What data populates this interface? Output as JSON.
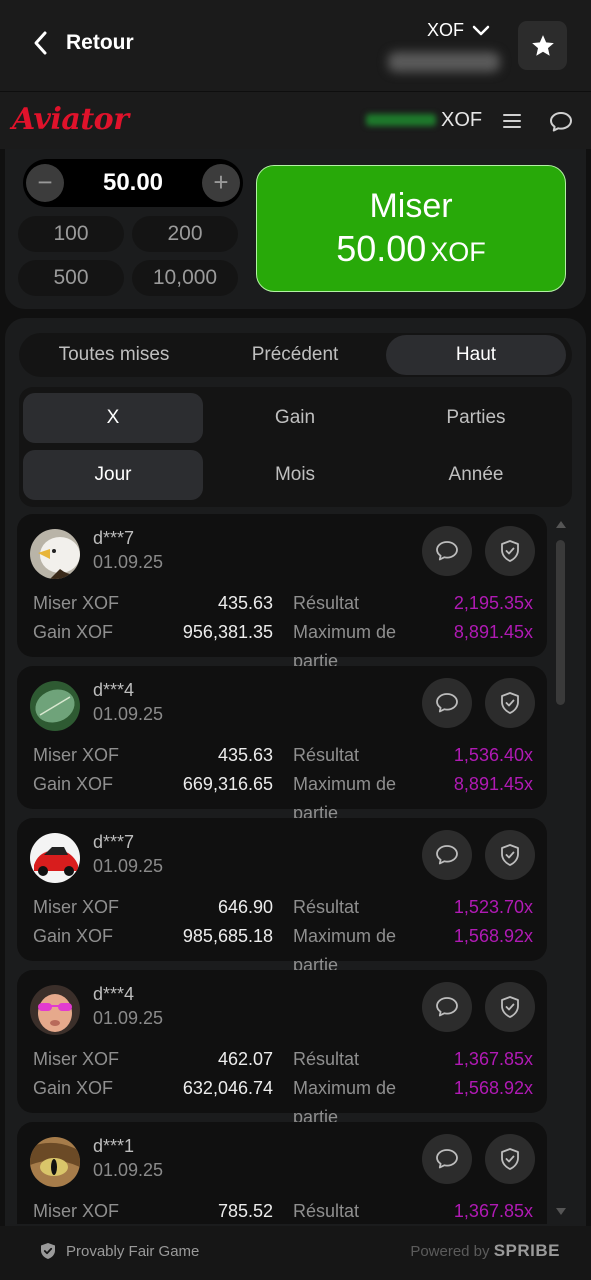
{
  "topbar": {
    "back_label": "Retour",
    "currency": "XOF"
  },
  "game_header": {
    "logo": "Aviator",
    "currency": "XOF"
  },
  "bet": {
    "amount": "50.00",
    "minus": "−",
    "plus": "+",
    "quick": [
      "100",
      "200",
      "500",
      "10,000"
    ],
    "button_label": "Miser",
    "button_amount": "50.00",
    "button_currency": "XOF"
  },
  "tabs": [
    "Toutes mises",
    "Précédent",
    "Haut"
  ],
  "active_tab": "Haut",
  "filters": {
    "row1": [
      "X",
      "Gain",
      "Parties"
    ],
    "row2": [
      "Jour",
      "Mois",
      "Année"
    ],
    "active": [
      "X",
      "Jour"
    ]
  },
  "labels": {
    "bet": "Miser XOF",
    "win": "Gain XOF",
    "result": "Résultat",
    "round_max_1": "Maximum de",
    "round_max_2": "partie"
  },
  "entries": [
    {
      "user": "d***7",
      "date": "01.09.25",
      "bet": "435.63",
      "win": "956,381.35",
      "result": "2,195.35x",
      "round_max": "8,891.45x",
      "avatar": "eagle"
    },
    {
      "user": "d***4",
      "date": "01.09.25",
      "bet": "435.63",
      "win": "669,316.65",
      "result": "1,536.40x",
      "round_max": "8,891.45x",
      "avatar": "leaf"
    },
    {
      "user": "d***7",
      "date": "01.09.25",
      "bet": "646.90",
      "win": "985,685.18",
      "result": "1,523.70x",
      "round_max": "1,568.92x",
      "avatar": "red-car"
    },
    {
      "user": "d***4",
      "date": "01.09.25",
      "bet": "462.07",
      "win": "632,046.74",
      "result": "1,367.85x",
      "round_max": "1,568.92x",
      "avatar": "baby-sunglasses"
    },
    {
      "user": "d***1",
      "date": "01.09.25",
      "bet": "785.52",
      "win": "",
      "result": "1,367.85x",
      "round_max": "",
      "avatar": "cat-eye"
    }
  ],
  "footer": {
    "provably_fair": "Provably Fair Game",
    "powered_by": "Powered by",
    "brand": "SPRIBE"
  },
  "colors": {
    "brand_red": "#e0122b",
    "bet_green": "#28a909",
    "multiplier_magenta": "#b01ab4",
    "background": "#101010",
    "panel": "#1b1c1d"
  },
  "icons": [
    "chevron-left-icon",
    "chevron-down-icon",
    "star-icon",
    "menu-icon",
    "chat-icon",
    "shield-check-icon"
  ]
}
